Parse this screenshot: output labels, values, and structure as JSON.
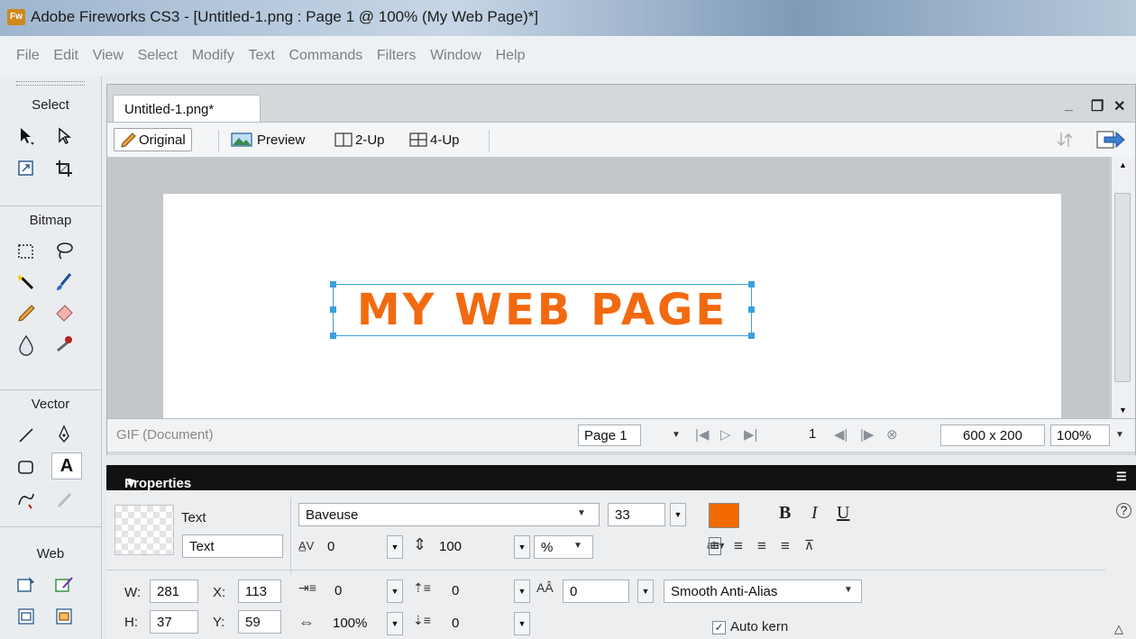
{
  "window": {
    "app_icon": "Fw",
    "title": "Adobe Fireworks CS3 - [Untitled-1.png : Page 1 @ 100% (My Web Page)*]"
  },
  "menu": [
    "File",
    "Edit",
    "View",
    "Select",
    "Modify",
    "Text",
    "Commands",
    "Filters",
    "Window",
    "Help"
  ],
  "tools": {
    "sections": [
      "Select",
      "Bitmap",
      "Vector",
      "Web"
    ]
  },
  "document": {
    "tab": "Untitled-1.png*",
    "window_controls": {
      "minimize": "_",
      "restore": "❐",
      "close": "✕"
    },
    "views": {
      "original": "Original",
      "preview": "Preview",
      "two_up": "2-Up",
      "four_up": "4-Up"
    },
    "canvas_text": "MY WEB PAGE",
    "canvas_text_color": "#f26a10"
  },
  "status": {
    "format": "GIF (Document)",
    "page": "Page 1",
    "frame": "1",
    "size": "600 x 200",
    "zoom": "100%"
  },
  "properties": {
    "header": "Properties",
    "type_label": "Text",
    "name_value": "Text",
    "font": "Baveuse",
    "font_size": "33",
    "fill_color": "#f26a00",
    "bold": "B",
    "italic": "I",
    "underline": "U",
    "kerning": "0",
    "leading": "100",
    "leading_unit": "%",
    "w_label": "W:",
    "w": "281",
    "x_label": "X:",
    "x": "113",
    "h_label": "H:",
    "h": "37",
    "y_label": "Y:",
    "y": "59",
    "indent": "0",
    "space_before": "0",
    "baseline_shift": "0",
    "horizontal_scale": "100%",
    "space_after": "0",
    "anti_alias": "Smooth Anti-Alias",
    "auto_kern_label": "Auto kern",
    "auto_kern": true,
    "help": "?"
  }
}
